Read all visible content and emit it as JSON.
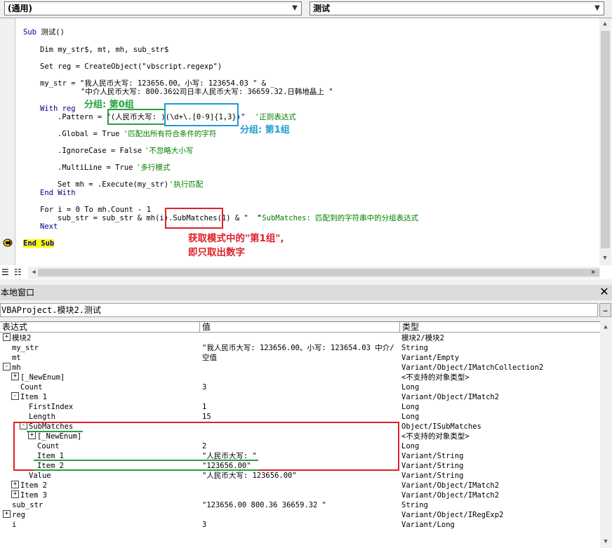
{
  "toolbar": {
    "object_combo": "(通用)",
    "proc_combo": "测试"
  },
  "code": {
    "lines": [
      "Sub 测试()",
      "Dim my_str$, mt, mh, sub_str$",
      "Set reg = CreateObject(\"vbscript.regexp\")",
      "my_str = \"我人民币大写: 123656.00。小写: 123654.03 \" & _",
      "\"中介人民币大写: 800.36公司日丰人民币大写: 36659.32.日韩地晶上 \"",
      "With reg",
      ".Pattern = \"(人民币大写: )(\\d+\\.[0-9]{1,3})\"",
      "'正则表达式",
      ".Global = True",
      "'匹配出所有符合条件的字符",
      ".IgnoreCase = False",
      "'不忽略大小写",
      ".MultiLine = True",
      "'多行模式",
      "Set mh = .Execute(my_str)",
      "'执行匹配",
      "End With",
      "For i = 0 To mh.Count - 1",
      "sub_str = sub_str & mh(i).SubMatches(1) & \"  \"",
      "'SubMatches: 匹配到的字符串中的分组表达式",
      "Next",
      "End Sub"
    ]
  },
  "annotations": {
    "group0": "分组: 第0组",
    "group1": "分组: 第1组",
    "submatch_line1": "获取模式中的\"第1组\",",
    "submatch_line2": "即只取出数字"
  },
  "locals": {
    "title": "本地窗口",
    "context": "VBAProject.模块2.测试",
    "headers": [
      "表达式",
      "值",
      "类型"
    ],
    "rows": [
      {
        "toggle": "+",
        "expr": "模块2",
        "value": "",
        "type": "模块2/模块2"
      },
      {
        "toggle": "",
        "expr": "my_str",
        "value": "\"我人民币大写: 123656.00。小写: 123654.03 中介/",
        "type": "String"
      },
      {
        "toggle": "",
        "expr": "mt",
        "value": "空值",
        "type": "Variant/Empty"
      },
      {
        "toggle": "-",
        "expr": "mh",
        "value": "",
        "type": "Variant/Object/IMatchCollection2"
      },
      {
        "toggle": "+",
        "expr": "[_NewEnum]",
        "value": "",
        "type": "<不支持的对象类型>"
      },
      {
        "toggle": "",
        "expr": "Count",
        "value": "3",
        "type": "Long"
      },
      {
        "toggle": "-",
        "expr": "Item 1",
        "value": "",
        "type": "Variant/Object/IMatch2"
      },
      {
        "toggle": "",
        "expr": "FirstIndex",
        "value": "1",
        "type": "Long"
      },
      {
        "toggle": "",
        "expr": "Length",
        "value": "15",
        "type": "Long"
      },
      {
        "toggle": "-",
        "expr": "SubMatches",
        "value": "",
        "type": "Object/ISubMatches"
      },
      {
        "toggle": "+",
        "expr": "[_NewEnum]",
        "value": "",
        "type": "<不支持的对象类型>"
      },
      {
        "toggle": "",
        "expr": "Count",
        "value": "2",
        "type": "Long"
      },
      {
        "toggle": "",
        "expr": "Item 1",
        "value": "\"人民币大写: \"",
        "type": "Variant/String"
      },
      {
        "toggle": "",
        "expr": "Item 2",
        "value": "\"123656.00\"",
        "type": "Variant/String"
      },
      {
        "toggle": "",
        "expr": "Value",
        "value": "\"人民币大写: 123656.00\"",
        "type": "Variant/String"
      },
      {
        "toggle": "+",
        "expr": "Item 2",
        "value": "",
        "type": "Variant/Object/IMatch2"
      },
      {
        "toggle": "+",
        "expr": "Item 3",
        "value": "",
        "type": "Variant/Object/IMatch2"
      },
      {
        "toggle": "",
        "expr": "sub_str",
        "value": "\"123656.00  800.36  36659.32  \"",
        "type": "String"
      },
      {
        "toggle": "+",
        "expr": "reg",
        "value": "",
        "type": "Variant/Object/IRegExp2"
      },
      {
        "toggle": "",
        "expr": "i",
        "value": "3",
        "type": "Variant/Long"
      }
    ]
  },
  "colors": {
    "keyword": "#00008b",
    "comment": "#008000",
    "annotation_green": "#22a33a",
    "annotation_blue": "#1e9bd7",
    "annotation_red": "#e0202a"
  }
}
